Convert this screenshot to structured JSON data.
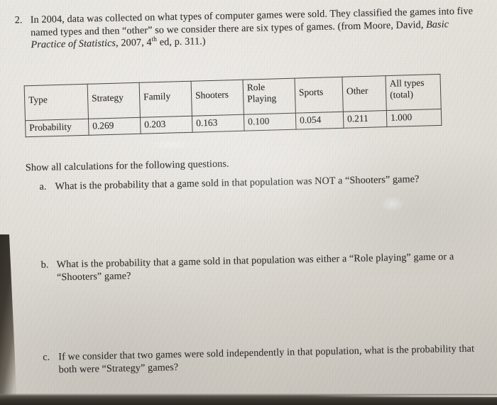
{
  "document": {
    "kind": "worksheet-scan",
    "paper_color": "#e4e1da",
    "ink_color": "#2e2c2b"
  },
  "problem": {
    "number": "2.",
    "intro_line1": "In 2004, data was collected on what types of computer games were sold.   They classified the games into",
    "intro_line2": "five named types and then “other” so we consider there are six types of games. (from Moore, David, ",
    "citation_italic_1": "Basic",
    "citation_italic_2": "Practice of Statistics",
    "citation_rest_a": ", 2007,  4",
    "citation_sup": "th",
    "citation_rest_b": " ed, p. 311.)"
  },
  "table": {
    "headers": [
      "Type",
      "Strategy",
      "Family",
      "Shooters",
      "Role Playing",
      "Sports",
      "Other",
      "All types (total)"
    ],
    "header_cells": [
      {
        "line1": "Type",
        "line2": ""
      },
      {
        "line1": "Strategy",
        "line2": ""
      },
      {
        "line1": "Family",
        "line2": ""
      },
      {
        "line1": "Shooters",
        "line2": ""
      },
      {
        "line1": "Role",
        "line2": "Playing"
      },
      {
        "line1": "Sports",
        "line2": ""
      },
      {
        "line1": "Other",
        "line2": ""
      },
      {
        "line1": "All types",
        "line2": "(total)"
      }
    ],
    "row_label": "Probability",
    "values": [
      "0.269",
      "0.203",
      "0.163",
      "0.100",
      "0.054",
      "0.211",
      "1.000"
    ]
  },
  "instruction": "Show all calculations for the following questions.",
  "questions": [
    {
      "marker": "a.",
      "line1": "What is the probability that a game sold in that population was NOT a “Shooters” game?",
      "line2": ""
    },
    {
      "marker": "b.",
      "line1": "What is the probability that a game sold in that population was either a “Role playing” game or a",
      "line2": "“Shooters” game?"
    },
    {
      "marker": "c.",
      "line1": "If we consider that two games were sold independently in that population, what is the probability that",
      "line2": "both were “Strategy” games?"
    }
  ],
  "chart_data": {
    "type": "table",
    "title": "Probability distribution of computer game types sold, 2004",
    "categories": [
      "Strategy",
      "Family",
      "Shooters",
      "Role Playing",
      "Sports",
      "Other"
    ],
    "values": [
      0.269,
      0.203,
      0.163,
      0.1,
      0.054,
      0.211
    ],
    "total": 1.0,
    "xlabel": "Type",
    "ylabel": "Probability",
    "ylim": [
      0,
      1
    ]
  }
}
